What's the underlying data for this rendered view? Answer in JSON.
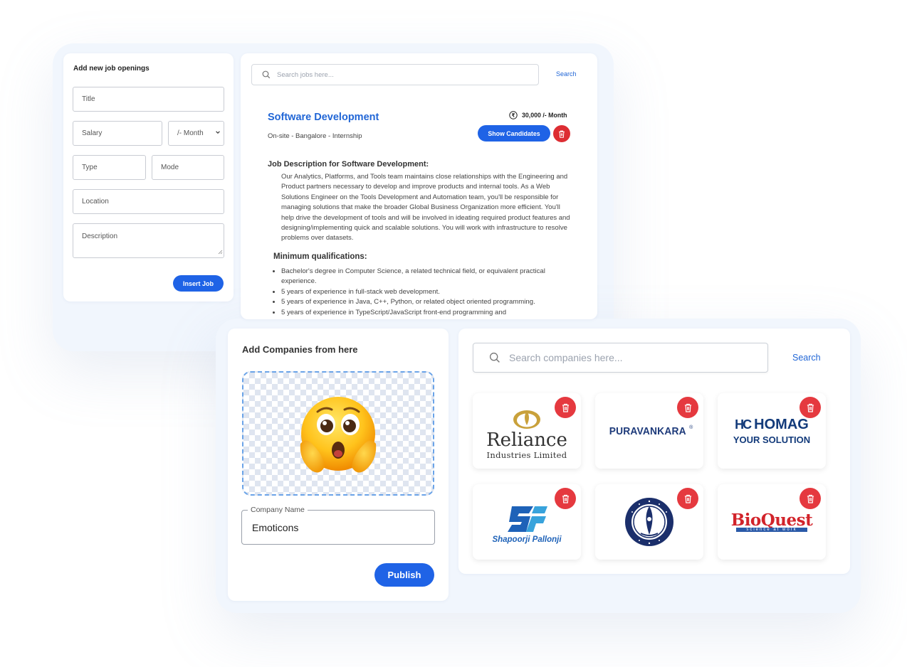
{
  "job_form": {
    "title": "Add new job openings",
    "title_placeholder": "Title",
    "salary_placeholder": "Salary",
    "salary_period": "/- Month",
    "type_placeholder": "Type",
    "mode_placeholder": "Mode",
    "location_placeholder": "Location",
    "description_placeholder": "Description",
    "insert_label": "Insert Job"
  },
  "job_search": {
    "placeholder": "Search jobs here...",
    "button_label": "Search"
  },
  "job": {
    "title": "Software Development",
    "meta": "On-site - Bangalore - Internship",
    "salary": "30,000 /- Month",
    "show_candidates_label": "Show Candidates",
    "description_heading": "Job Description for Software Development:",
    "description": "Our Analytics, Platforms, and Tools team maintains close relationships with the Engineering and Product partners necessary to develop and improve products and internal tools. As a Web Solutions Engineer on the Tools Development and Automation team, you'll be responsible for managing solutions that make the broader Global Business Organization more efficient. You'll help drive the development of tools and will be involved in ideating required product features and designing/implementing quick and scalable solutions. You will work with infrastructure to resolve problems over datasets.",
    "qualifications_heading": "Minimum qualifications:",
    "qualifications": [
      "Bachelor's degree in Computer Science, a related technical field, or equivalent practical experience.",
      "5 years of experience in full-stack web development.",
      "5 years of experience in Java, C++, Python, or related object oriented programming.",
      "5 years of experience in TypeScript/JavaScript front-end programming and"
    ]
  },
  "company_form": {
    "title": "Add Companies from here",
    "company_name_label": "Company Name",
    "company_name_value": "Emoticons",
    "publish_label": "Publish"
  },
  "company_search": {
    "placeholder": "Search companies here...",
    "button_label": "Search"
  },
  "companies": {
    "reliance": {
      "name": "Reliance",
      "subtitle": "Industries Limited"
    },
    "puravankara": {
      "name": "PURAVANKARA"
    },
    "homag": {
      "mark": "HC",
      "name": "HOMAG",
      "tagline": "YOUR SOLUTION"
    },
    "shapoorji": {
      "mark": "SP",
      "name": "Shapoorji Pallonji"
    },
    "cuk": {
      "name": "Central University of Kerala"
    },
    "bioquest": {
      "name": "BioQuest",
      "tagline": "science at work"
    }
  },
  "colors": {
    "primary": "#1f63e6",
    "delete": "#e5393f",
    "job_title": "#2166d6"
  }
}
